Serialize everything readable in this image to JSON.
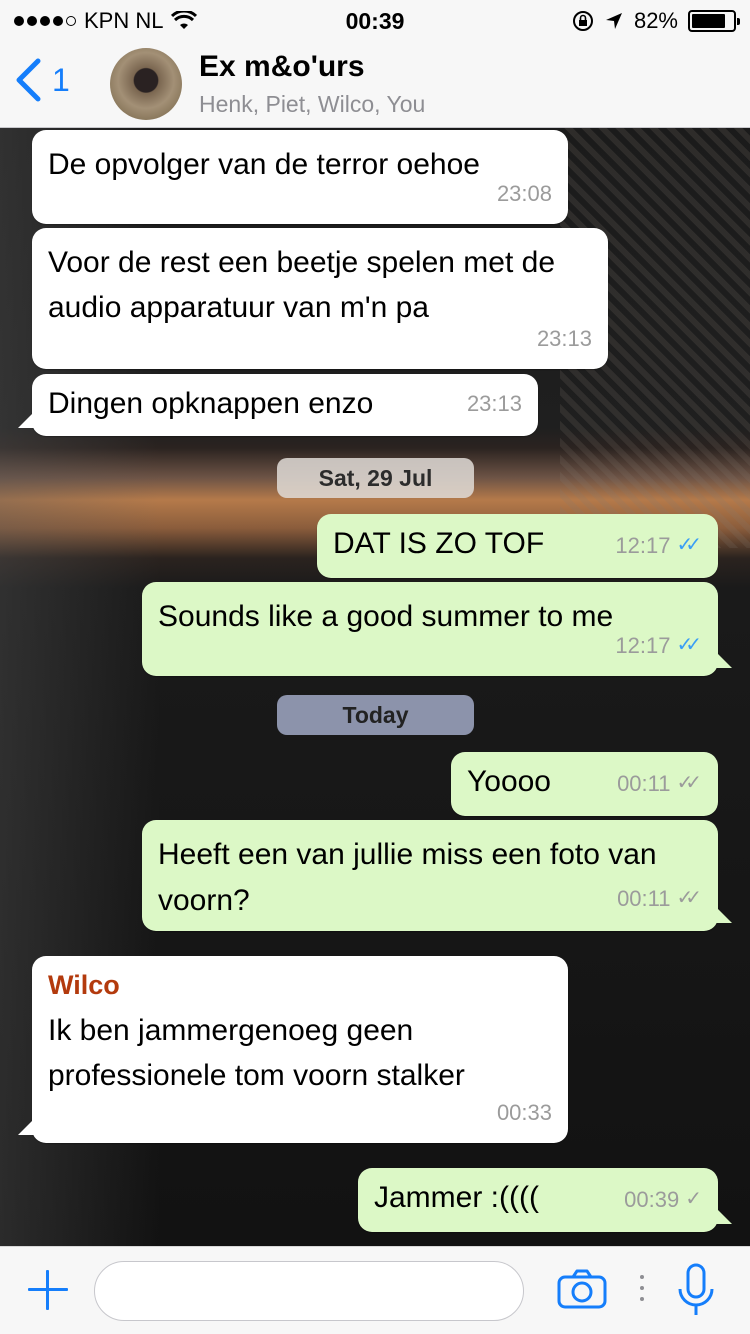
{
  "status_bar": {
    "carrier": "KPN NL",
    "time": "00:39",
    "battery": "82%",
    "battery_level": 0.82
  },
  "header": {
    "back_count": "1",
    "title": "Ex m&o'urs",
    "subtitle": "Henk, Piet, Wilco, You"
  },
  "messages": [
    {
      "dir": "in",
      "text": "De opvolger van de terror oehoe",
      "time": "23:08"
    },
    {
      "dir": "in",
      "text": "Voor de rest een beetje spelen met de audio apparatuur van m'n pa",
      "time": "23:13"
    },
    {
      "dir": "in",
      "text": "Dingen opknappen enzo",
      "time": "23:13"
    },
    {
      "dir": "out",
      "text": "DAT IS ZO TOF",
      "time": "12:17",
      "status": "read"
    },
    {
      "dir": "out",
      "text": "Sounds like a good summer to me",
      "time": "12:17",
      "status": "read"
    },
    {
      "dir": "out",
      "text": "Yoooo",
      "time": "00:11",
      "status": "delivered"
    },
    {
      "dir": "out",
      "text": "Heeft een van jullie miss een foto van voorn?",
      "time": "00:11",
      "status": "delivered"
    },
    {
      "dir": "in",
      "sender": "Wilco",
      "text": "Ik ben jammergenoeg geen professionele tom voorn stalker",
      "time": "00:33"
    },
    {
      "dir": "out",
      "text": "Jammer :((((",
      "time": "00:39",
      "status": "sent"
    }
  ],
  "date_separators": [
    "Sat, 29 Jul",
    "Today"
  ],
  "input": {
    "placeholder": ""
  },
  "icons": {
    "back": "chevron-left-icon",
    "attach": "plus-icon",
    "camera": "camera-icon",
    "mic": "microphone-icon"
  },
  "colors": {
    "accent": "#157efb",
    "incoming_bubble": "#ffffff",
    "outgoing_bubble": "#dcf8c6",
    "read_ticks": "#3a9ef5",
    "sender_name": "#b33a0d"
  }
}
